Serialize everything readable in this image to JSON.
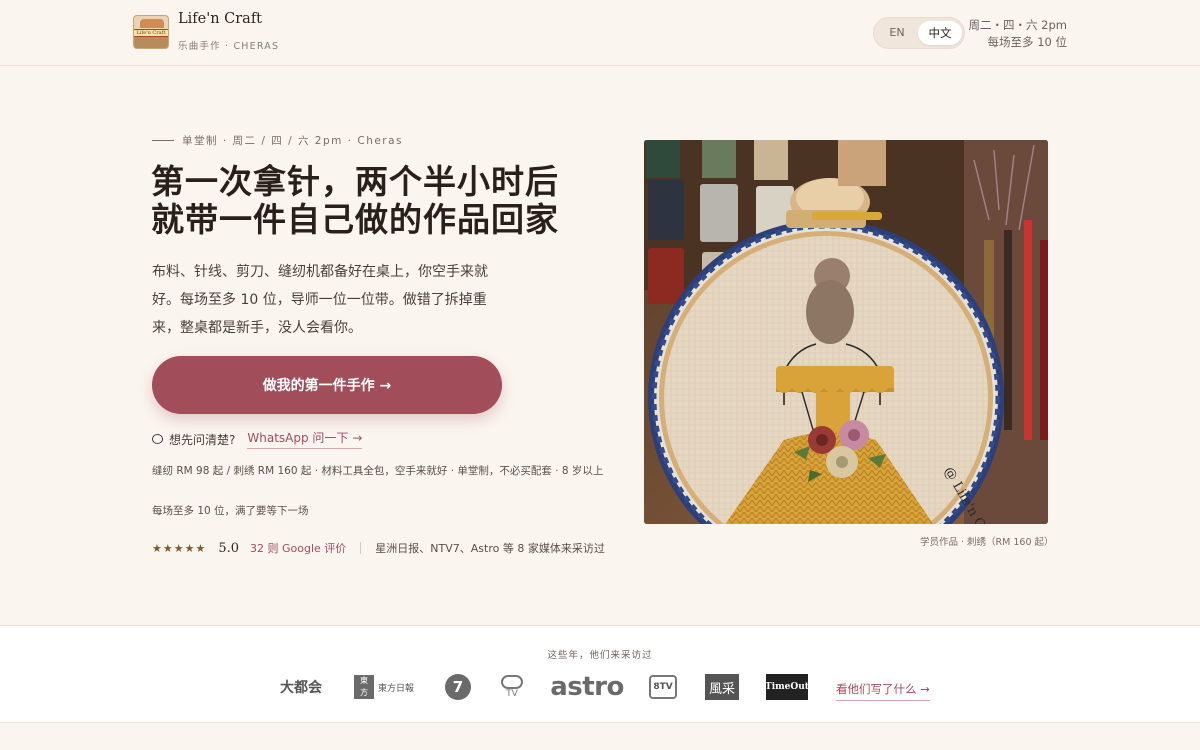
{
  "header": {
    "brand_name": "Life'n Craft",
    "brand_sub": "乐曲手作 · CHERAS",
    "lang_en": "EN",
    "lang_zh": "中文",
    "schedule_line1": "周二・四・六 2pm",
    "schedule_line2": "每场至多 10 位"
  },
  "hero": {
    "eyebrow": "单堂制 · 周二 / 四 / 六 2pm · Cheras",
    "headline_line1": "第一次拿针，两个半小时后",
    "headline_line2": "就带一件自己做的作品回家",
    "description": "布料、针线、剪刀、缝纫机都备好在桌上，你空手来就好。每场至多 10 位，导师一位一位带。做错了拆掉重来，整桌都是新手，没人会看你。",
    "cta_label": "做我的第一件手作 →",
    "ask_text": "想先问清楚?",
    "whatsapp_label": "WhatsApp 问一下 →",
    "meta_line1": "缝纫 RM 98 起 / 刺绣 RM 160 起 · 材料工具全包，空手来就好 · 单堂制，不必买配套 · 8 岁以上",
    "meta_line2": "每场至多 10 位，满了要等下一场",
    "stars": "★★★★★",
    "rating_score": "5.0",
    "google_reviews": "32 则 Google 评价",
    "media_text": "星洲日报、NTV7、Astro 等 8 家媒体来采访过",
    "photo_caption": "学员作品 · 刺绣（RM 160 起）",
    "photo_watermark": "@ Life'n Craft"
  },
  "press": {
    "title": "这些年，他们来采访过",
    "logos": [
      "大都会",
      "東方日報",
      "7",
      "TV",
      "astro",
      "8TV",
      "風采",
      "TimeOut"
    ],
    "link_label": "看他们写了什么 →"
  },
  "colors": {
    "background": "#fbf5ef",
    "accent": "#a14d5a",
    "text": "#3a2f2a"
  }
}
